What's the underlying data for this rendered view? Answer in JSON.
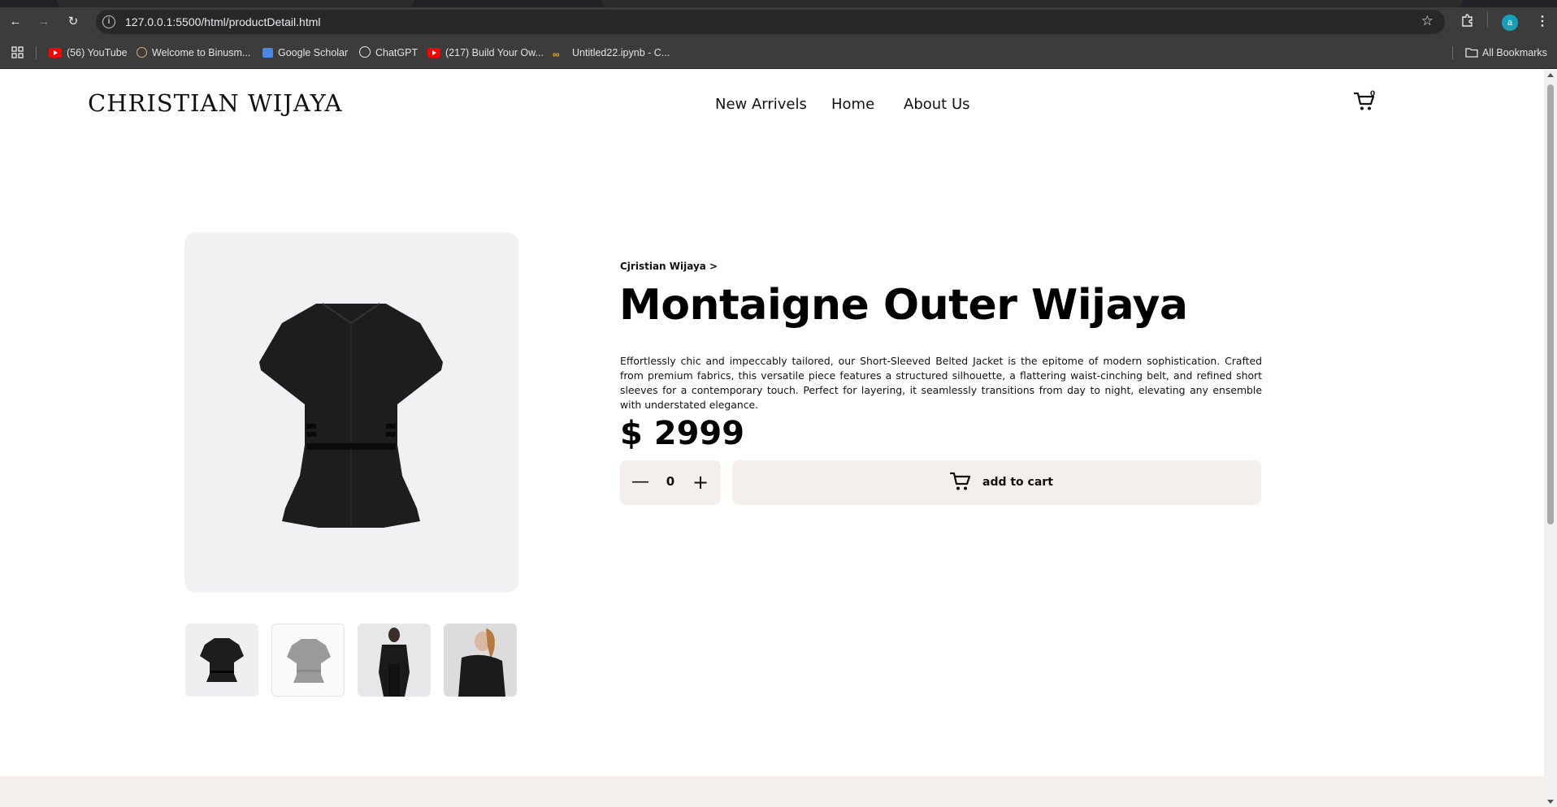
{
  "browser": {
    "url": "127.0.0.1:5500/html/productDetail.html",
    "profile_initial": "a",
    "bookmarks": [
      {
        "label": "(56) YouTube",
        "icon": "youtube-icon"
      },
      {
        "label": "Welcome to Binusm...",
        "icon": "binus-icon"
      },
      {
        "label": "Google Scholar",
        "icon": "scholar-icon"
      },
      {
        "label": "ChatGPT",
        "icon": "chatgpt-icon"
      },
      {
        "label": "(217) Build Your Ow...",
        "icon": "youtube-icon"
      },
      {
        "label": "Untitled22.ipynb - C...",
        "icon": "colab-icon"
      }
    ],
    "all_bookmarks": "All Bookmarks"
  },
  "header": {
    "logo": "CHRISTIAN WIJAYA",
    "nav": [
      "New Arrivels",
      "Home",
      "About Us"
    ],
    "cart_count": "0"
  },
  "product": {
    "breadcrumb": "Cjristian Wijaya >",
    "title": "Montaigne Outer Wijaya",
    "description": "Effortlessly chic and impeccably tailored, our Short-Sleeved Belted Jacket is the epitome of modern sophistication. Crafted from premium fabrics, this versatile piece features a structured silhouette, a flattering waist-cinching belt, and refined short sleeves for a contemporary touch. Perfect for layering, it seamlessly transitions from day to night, elevating any ensemble with understated elegance.",
    "price": "$ 2999",
    "quantity": "0",
    "add_to_cart": "add to cart"
  },
  "colors": {
    "accent_bg": "#f4efeb",
    "image_bg": "#f1f1f3",
    "text": "#111111"
  }
}
